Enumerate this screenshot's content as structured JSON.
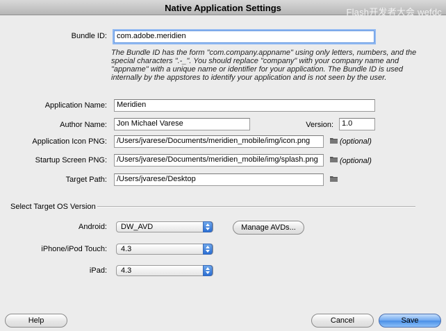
{
  "window": {
    "title": "Native Application Settings",
    "watermark": "Flash开发者大会 wefdc"
  },
  "form": {
    "bundle_id": {
      "label": "Bundle ID:",
      "value": "com.adobe.meridien"
    },
    "help_text": "The Bundle ID has the form \"com.company.appname\" using only letters, numbers, and the special characters \".-_\". You should replace \"company\" with your company name and \"appname\" with a unique name or identifier for your application. The Bundle ID is used internally by the appstores to identify your application and is not seen by the user.",
    "application_name": {
      "label": "Application Name:",
      "value": "Meridien"
    },
    "author_name": {
      "label": "Author Name:",
      "value": "Jon Michael Varese"
    },
    "version": {
      "label": "Version:",
      "value": "1.0"
    },
    "application_icon": {
      "label": "Application Icon PNG:",
      "value": "/Users/jvarese/Documents/meridien_mobile/img/icon.png",
      "note": "(optional)"
    },
    "startup_screen": {
      "label": "Startup Screen PNG:",
      "value": "/Users/jvarese/Documents/meridien_mobile/img/splash.png",
      "note": "(optional)"
    },
    "target_path": {
      "label": "Target Path:",
      "value": "/Users/jvarese/Desktop"
    }
  },
  "target_os": {
    "section_label": "Select Target OS Version",
    "android": {
      "label": "Android:",
      "selected": "DW_AVD",
      "manage_button": "Manage AVDs..."
    },
    "iphone": {
      "label": "iPhone/iPod Touch:",
      "selected": "4.3"
    },
    "ipad": {
      "label": "iPad:",
      "selected": "4.3"
    }
  },
  "buttons": {
    "help": "Help",
    "cancel": "Cancel",
    "save": "Save"
  },
  "icons": {
    "folder": "folder-icon",
    "popup": "popup-arrows-icon"
  }
}
